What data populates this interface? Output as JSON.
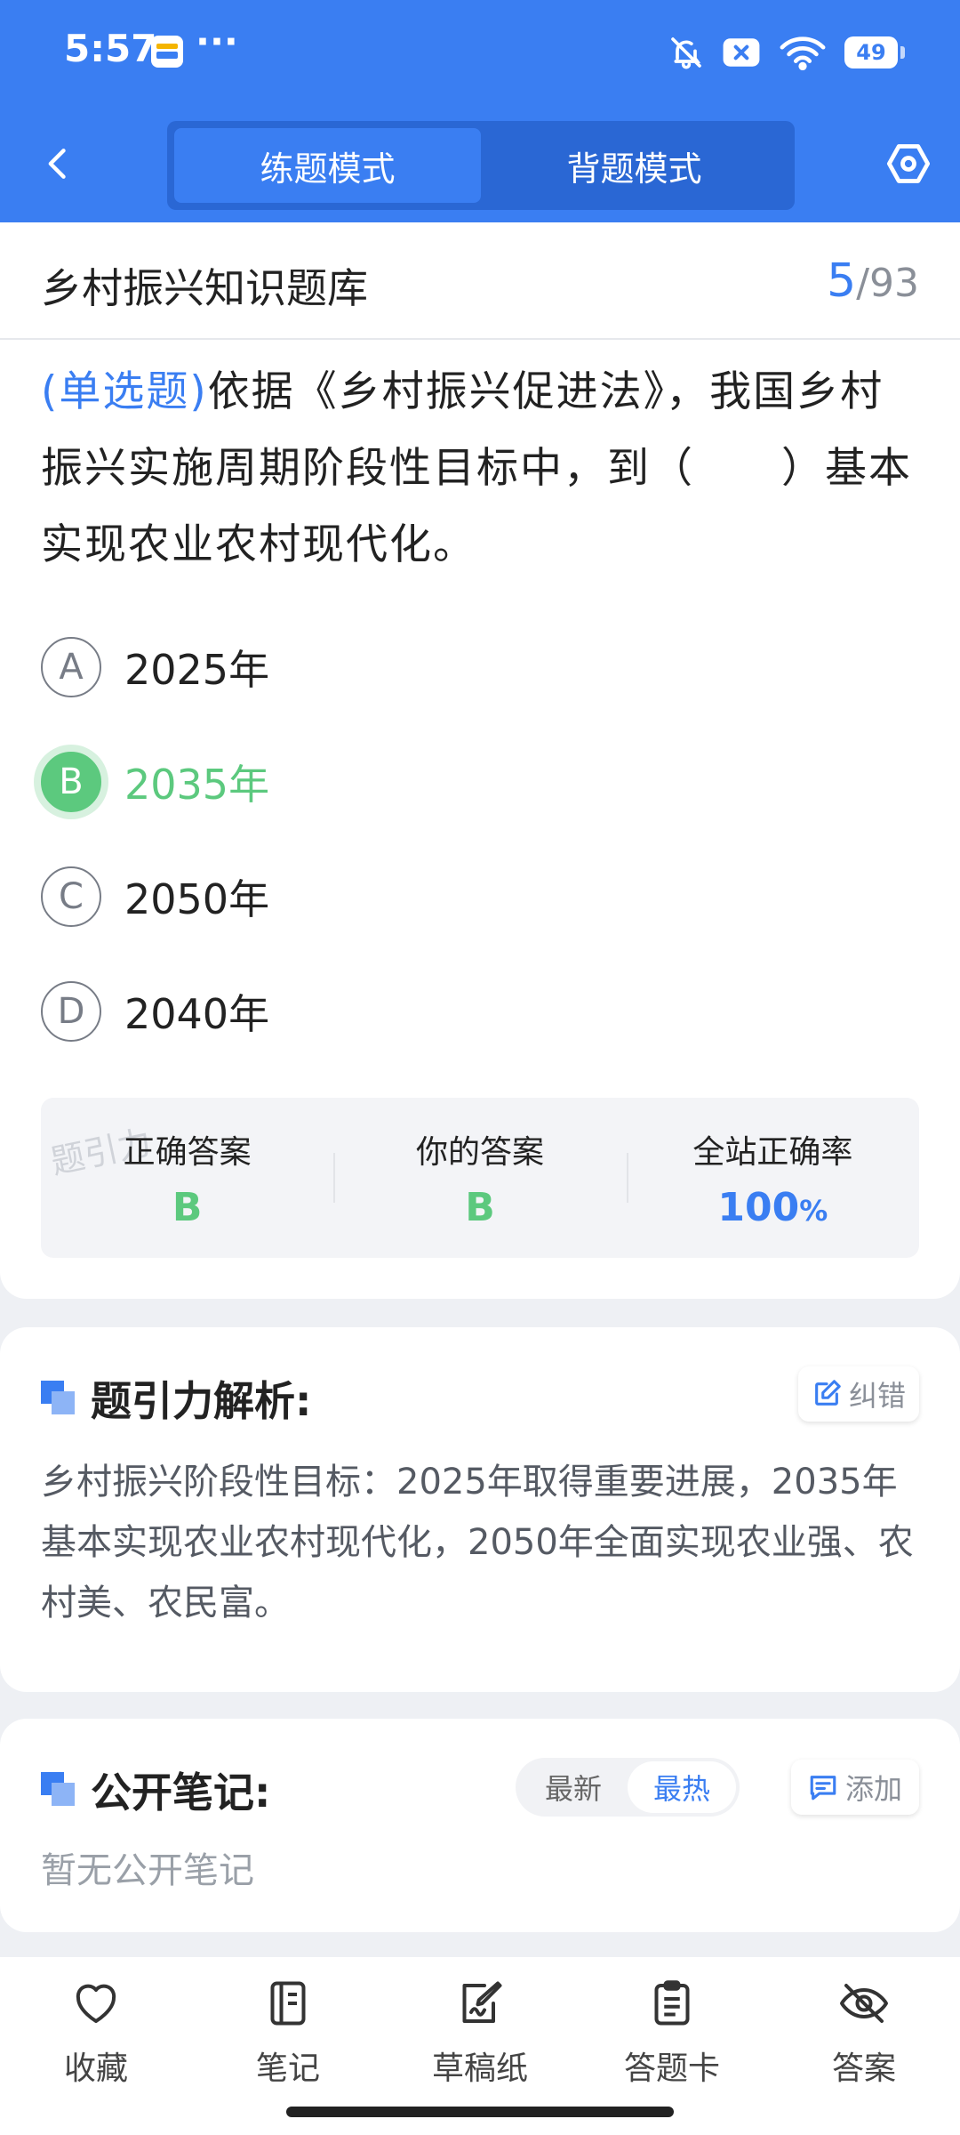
{
  "status_bar": {
    "time": "5:57",
    "more": "···",
    "battery": "49",
    "icons": [
      "wallet-icon",
      "bell-muted-icon",
      "sim-x-icon",
      "wifi-icon",
      "battery-icon"
    ]
  },
  "nav": {
    "tabs": [
      {
        "label": "练题模式",
        "active": true
      },
      {
        "label": "背题模式",
        "active": false
      }
    ]
  },
  "bank": {
    "title": "乡村振兴知识题库",
    "current": "5",
    "sep_total": "/93"
  },
  "question": {
    "type": "(单选题)",
    "text": "依据《乡村振兴促进法》，我国乡村振兴实施周期阶段性目标中，到（　　）基本实现农业农村现代化。"
  },
  "options": [
    {
      "letter": "A",
      "text": "2025年",
      "state": "normal"
    },
    {
      "letter": "B",
      "text": "2035年",
      "state": "correct"
    },
    {
      "letter": "C",
      "text": "2050年",
      "state": "normal"
    },
    {
      "letter": "D",
      "text": "2040年",
      "state": "normal"
    }
  ],
  "answers": {
    "correct_label": "正确答案",
    "correct_value": "B",
    "yours_label": "你的答案",
    "yours_value": "B",
    "rate_label": "全站正确率",
    "rate_value": "100",
    "rate_unit": "%",
    "watermark": "题引力"
  },
  "analysis": {
    "title": "题引力解析:",
    "correct_button": "纠错",
    "text": "乡村振兴阶段性目标：2025年取得重要进展，2035年基本实现农业农村现代化，2050年全面实现农业强、农村美、农民富。"
  },
  "notes": {
    "title": "公开笔记:",
    "sort_tabs": [
      {
        "label": "最新",
        "active": false
      },
      {
        "label": "最热",
        "active": true
      }
    ],
    "add_button": "添加",
    "empty": "暂无公开笔记"
  },
  "bottom_bar": {
    "favorite": "收藏",
    "note": "笔记",
    "draft": "草稿纸",
    "answer_card": "答题卡",
    "answer": "答案"
  },
  "colors": {
    "brand": "#3a7ef2",
    "correct": "#5cc97e"
  }
}
